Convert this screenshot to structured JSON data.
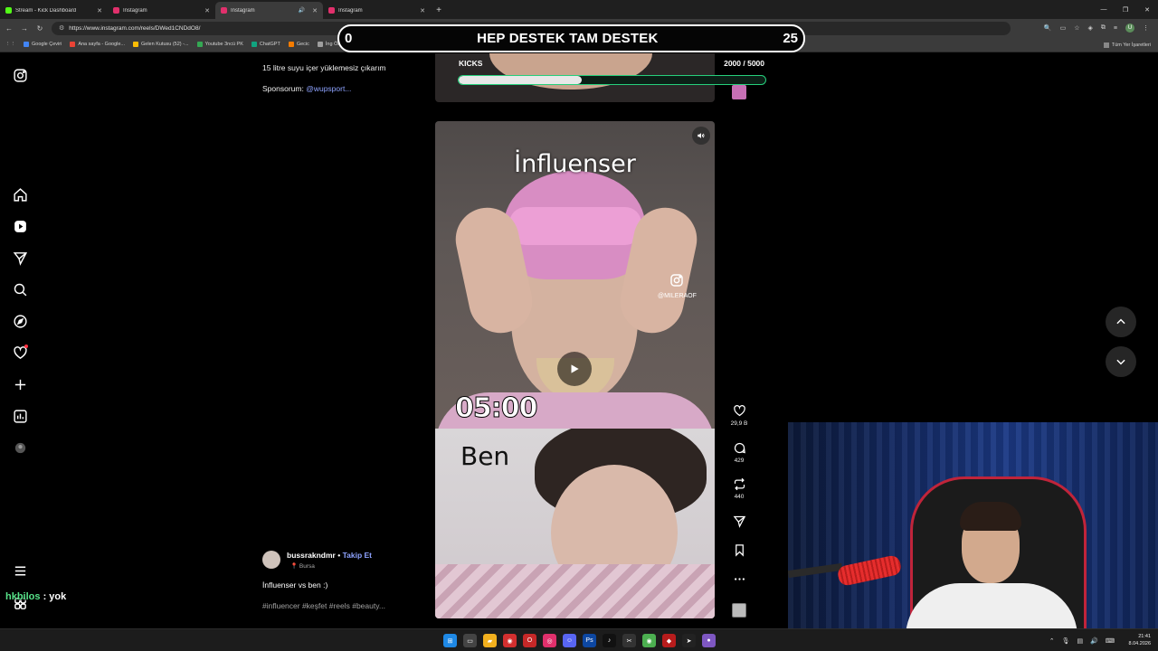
{
  "browser": {
    "tabs": [
      {
        "label": "Stream - Kick Dashboard",
        "favicon_color": "#53fc18",
        "active": false,
        "sound": false
      },
      {
        "label": "Instagram",
        "favicon_color": "#e1306c",
        "active": false,
        "sound": false
      },
      {
        "label": "Instagram",
        "favicon_color": "#e1306c",
        "active": true,
        "sound": true
      },
      {
        "label": "Instagram",
        "favicon_color": "#e1306c",
        "active": false,
        "sound": false
      }
    ],
    "url": "https://www.instagram.com/reels/DWed1CNDdO8/",
    "bookmarks": [
      "Google Çeviri",
      "Ana sayfa - Google...",
      "Gelen Kutusu (52) -...",
      "Youtube 3ncü PK",
      "ChatGPT",
      "Gecic",
      "İng Örnek",
      "Transcript of \"Mr M...",
      "Google Ç...",
      "Transcript...",
      "HeyGen - Projects",
      "BURÇ",
      "Esperanzas...",
      "The best ChatBot an...",
      "Flow"
    ],
    "bookmarks_right": "Tüm Yer İşaretleri",
    "profile_initial": "U"
  },
  "stream_goal": {
    "left_value": "0",
    "title": "HEP DESTEK TAM DESTEK",
    "right_value": "25"
  },
  "kicks": {
    "label": "KICKS",
    "value": "2000 / 5000",
    "progress": 0.4
  },
  "prev_post": {
    "caption": "15 litre suyu içer yüklemesiz çıkarım",
    "sponsor_prefix": "Sponsorum: ",
    "sponsor_handle": "@wupsport..."
  },
  "reel": {
    "text_top": "İnfluenser",
    "watermark_handle": "@MILERAOF",
    "time_text": "05:00",
    "text_bottom": "Ben"
  },
  "actions": {
    "likes": "29,9 B",
    "comments": "429",
    "reposts": "440"
  },
  "author": {
    "username": "bussrakndmr",
    "separator": " • ",
    "follow_label": "Takip Et",
    "location": "Bursa",
    "caption": "İnfluenser vs ben :)",
    "tags": "#influencer #keşfet #reels #beauty..."
  },
  "chat": {
    "user": "hkbilos",
    "message": " : yok"
  },
  "clock": {
    "time": "21:41",
    "date": "8.04.2026"
  },
  "colors": {
    "kick_green": "#26d07c",
    "link_blue": "#8ea3ff",
    "notification_red": "#ff3040"
  }
}
